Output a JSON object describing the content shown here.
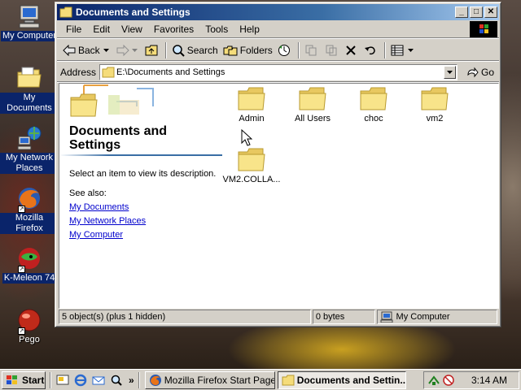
{
  "window": {
    "title": "Documents and Settings",
    "minimize_glyph": "_",
    "maximize_glyph": "□",
    "close_glyph": "✕"
  },
  "menu": [
    "File",
    "Edit",
    "View",
    "Favorites",
    "Tools",
    "Help"
  ],
  "toolbar": {
    "back": "Back",
    "search": "Search",
    "folders": "Folders"
  },
  "address": {
    "label": "Address",
    "value": "E:\\Documents and Settings",
    "go": "Go"
  },
  "infopane": {
    "title": "Documents and Settings",
    "description": "Select an item to view its description.",
    "see_also": "See also:",
    "links": [
      "My Documents",
      "My Network Places",
      "My Computer"
    ]
  },
  "folders": [
    "Admin",
    "All Users",
    "choc",
    "vm2",
    "VM2.COLLA..."
  ],
  "status": {
    "objects": "5 object(s) (plus 1 hidden)",
    "size": "0 bytes",
    "zone": "My Computer"
  },
  "desktop_icons": [
    "My Computer",
    "My Documents",
    "My Network Places",
    "Mozilla Firefox",
    "K-Meleon 74",
    "Pego"
  ],
  "taskbar": {
    "start": "Start",
    "quicklaunch_more": "»",
    "tasks": [
      "Mozilla Firefox Start Page...",
      "Documents and Settin..."
    ],
    "clock": "3:14 AM"
  },
  "colors": {
    "titlebar": "#0a246a",
    "folder": "#f5dc7a",
    "link": "#0000cc"
  }
}
